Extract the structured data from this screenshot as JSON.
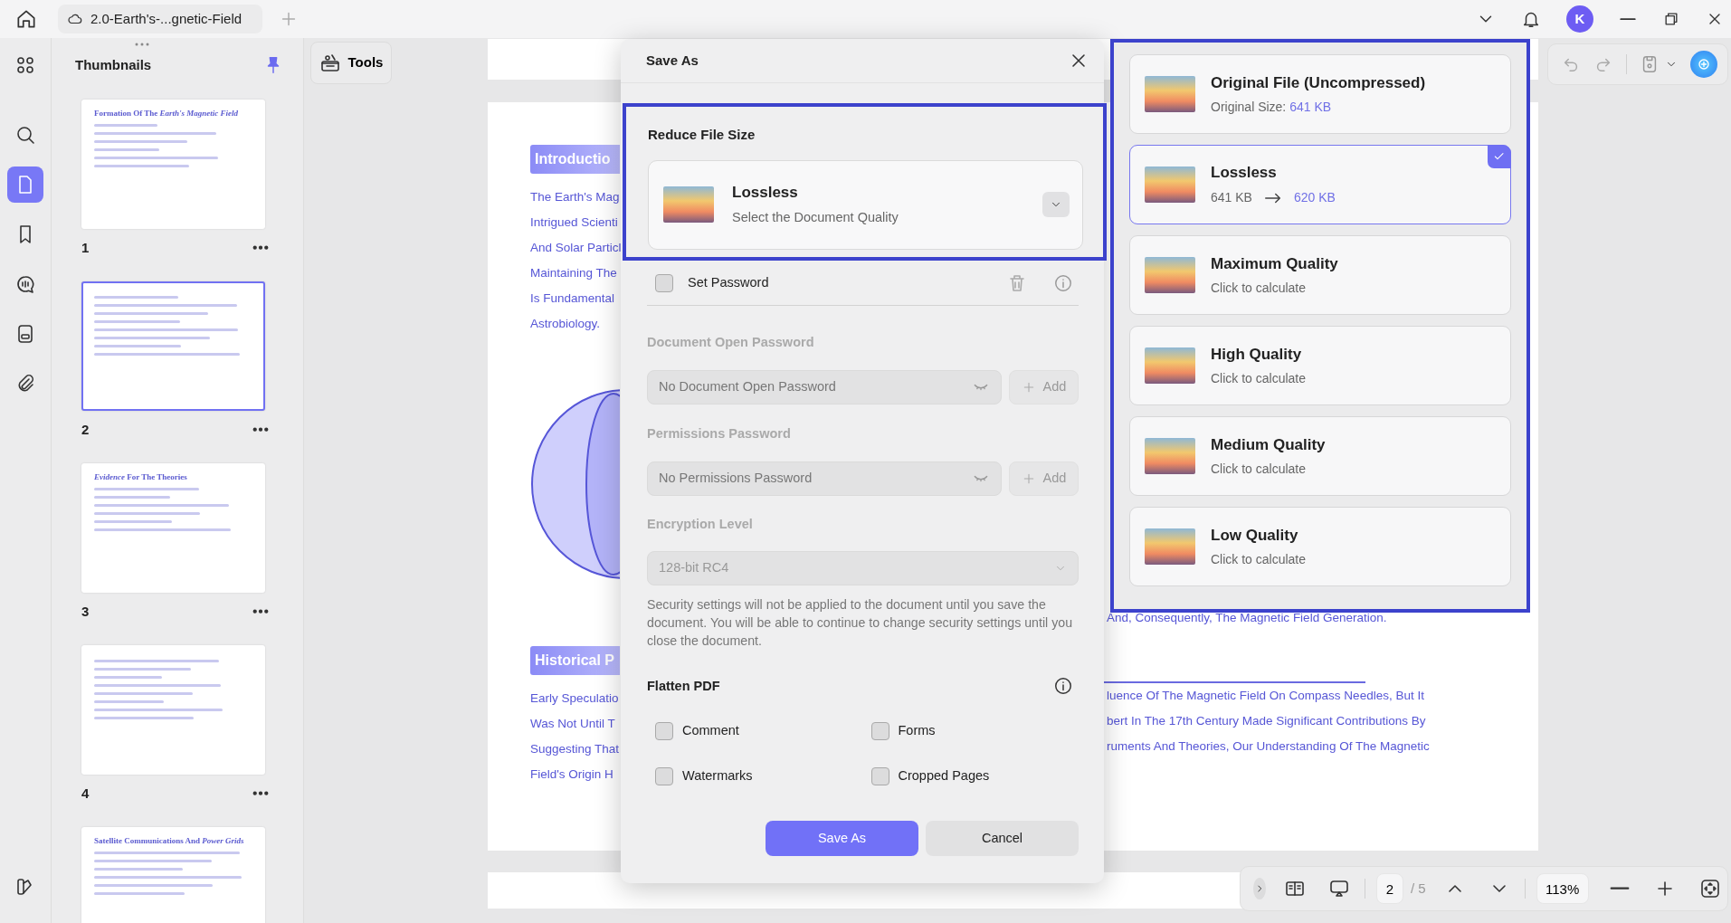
{
  "tab_bar": {
    "tab": {
      "title": "2.0-Earth's-...gnetic-Field"
    },
    "account": {
      "initial": "K"
    }
  },
  "sidebar": {
    "items": [
      {
        "kind": "grid",
        "selected": false
      },
      {
        "kind": "search",
        "selected": false
      },
      {
        "kind": "page",
        "selected": true
      },
      {
        "kind": "bookmark",
        "selected": false
      },
      {
        "kind": "comment",
        "selected": false
      },
      {
        "kind": "form",
        "selected": false
      },
      {
        "kind": "attachment",
        "selected": false
      }
    ]
  },
  "thumbnails": {
    "title": "Thumbnails",
    "pages": [
      {
        "label": "1",
        "title": "Formation Of The *Earth's Magnetic Field*",
        "selected": false
      },
      {
        "label": "2",
        "selected": true
      },
      {
        "label": "3",
        "title": "*Evidence* For The Theories",
        "selected": false
      },
      {
        "label": "4",
        "selected": false
      },
      {
        "title": "Satellite Communications And *Power Grids*",
        "selected": false
      }
    ]
  },
  "tools": {
    "label": "Tools"
  },
  "document": {
    "sections": [
      {
        "heading": "Introductio",
        "lines": [
          "The Earth's Mag",
          "Intrigued Scienti",
          "And Solar Particl",
          "Maintaining The",
          "Is Fundamental",
          "Astrobiology."
        ]
      },
      {
        "heading": "Historical P",
        "lines": [
          "Early Speculatio",
          "Was Not Until T",
          "Suggesting That",
          "Field's Origin H"
        ]
      }
    ],
    "right_lines": {
      "upper": [
        "And, Consequently, The Magnetic Field Generation."
      ],
      "lower": [
        "luence Of The Magnetic Field On Compass Needles, But It",
        "bert In The 17th Century Made Significant Contributions By",
        "ruments And Theories, Our Understanding Of The Magnetic"
      ]
    }
  },
  "dialog": {
    "title": "Save As",
    "reduce_file_size": {
      "heading": "Reduce File Size",
      "quality": {
        "title": "Lossless",
        "subtitle": "Select the Document Quality"
      }
    },
    "set_password": {
      "label": "Set Password",
      "checked": false
    },
    "open_password": {
      "heading": "Document Open Password",
      "value": "No Document Open Password",
      "add": "Add"
    },
    "permissions_password": {
      "heading": "Permissions Password",
      "value": "No Permissions Password",
      "add": "Add"
    },
    "encryption": {
      "heading": "Encryption Level",
      "value": "128-bit RC4"
    },
    "note": "Security settings will not be applied to the document until you save the document. You will be able to continue to change security settings until you close the document.",
    "flatten": {
      "heading": "Flatten PDF",
      "options": [
        {
          "label": "Comment",
          "checked": false
        },
        {
          "label": "Forms",
          "checked": false
        },
        {
          "label": "Watermarks",
          "checked": false
        },
        {
          "label": "Cropped Pages",
          "checked": false
        }
      ]
    },
    "buttons": [
      {
        "label": "Save As",
        "kind": "primary"
      },
      {
        "label": "Cancel",
        "kind": "secondary"
      }
    ]
  },
  "quality_menu": {
    "options": [
      {
        "kind": "original",
        "title": "Original File (Uncompressed)",
        "detail": "Original Size:",
        "value": "641 KB",
        "selected": false
      },
      {
        "kind": "compressed",
        "title": "Lossless",
        "detail": "641 KB",
        "value": "620 KB",
        "selected": true
      },
      {
        "kind": "pending",
        "title": "Maximum Quality",
        "detail": "Click to calculate",
        "selected": false
      },
      {
        "kind": "pending",
        "title": "High Quality",
        "detail": "Click to calculate",
        "selected": false
      },
      {
        "kind": "pending",
        "title": "Medium Quality",
        "detail": "Click to calculate",
        "selected": false
      },
      {
        "kind": "pending",
        "title": "Low Quality",
        "detail": "Click to calculate",
        "selected": false
      }
    ]
  },
  "page_nav": {
    "page": "2",
    "total": "/ 5",
    "zoom": "113%"
  }
}
